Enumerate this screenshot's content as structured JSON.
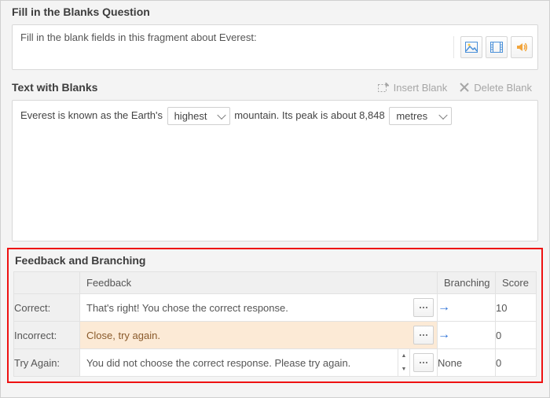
{
  "question": {
    "title": "Fill in the Blanks Question",
    "prompt": "Fill in the blank fields in this fragment about Everest:"
  },
  "blanks": {
    "title": "Text with Blanks",
    "insert_label": "Insert Blank",
    "delete_label": "Delete Blank",
    "segments": {
      "s1": "Everest is known as the Earth's",
      "blank1": "highest",
      "s2": "mountain. Its peak is about 8,848",
      "blank2": "metres"
    }
  },
  "feedback": {
    "title": "Feedback and Branching",
    "headers": {
      "feedback": "Feedback",
      "branching": "Branching",
      "score": "Score"
    },
    "rows": {
      "correct": {
        "label": "Correct:",
        "text": "That's right! You chose the correct response.",
        "branching": "→",
        "score": "10"
      },
      "incorrect": {
        "label": "Incorrect:",
        "text": "Close, try again.",
        "branching": "→",
        "score": "0"
      },
      "tryagain": {
        "label": "Try Again:",
        "text": "You did not choose the correct response. Please try again.",
        "branching": "None",
        "score": "0"
      }
    }
  }
}
